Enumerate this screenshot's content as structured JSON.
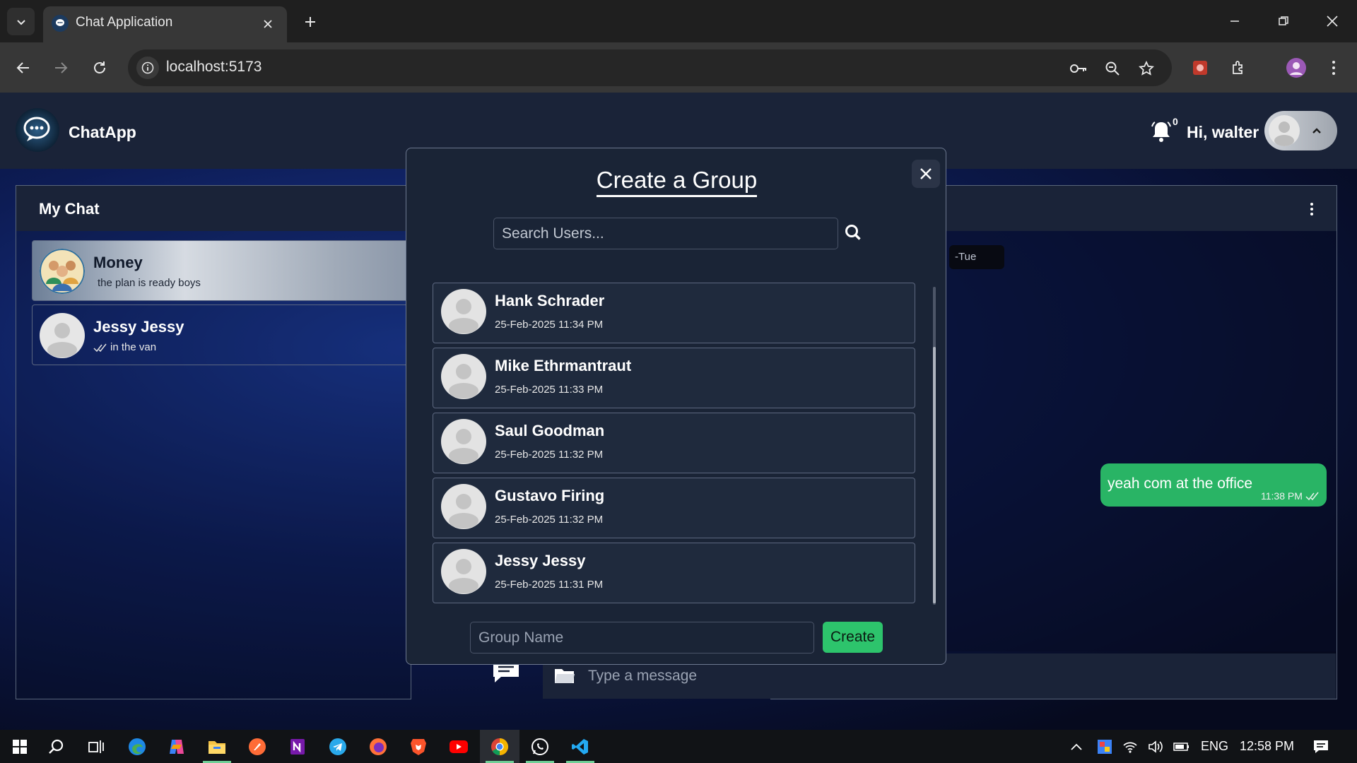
{
  "browser": {
    "tab_title": "Chat Application",
    "url": "localhost:5173"
  },
  "app": {
    "brand": "ChatApp",
    "notification_count": "0",
    "greeting": "Hi, walter"
  },
  "my_chat": {
    "title": "My Chat",
    "items": [
      {
        "name": "Money",
        "last_message": "the plan is ready boys",
        "active": true
      },
      {
        "name": "Jessy Jessy",
        "last_message": "in the van",
        "active": false
      }
    ]
  },
  "conversation": {
    "date_chip": "-Tue",
    "messages": [
      {
        "text": "yeah com at the office",
        "time": "11:38 PM",
        "sent": true
      }
    ],
    "input_placeholder": "Type a message"
  },
  "modal": {
    "title": "Create a Group",
    "search_placeholder": "Search Users...",
    "users": [
      {
        "name": "Hank Schrader",
        "date": "25-Feb-2025 11:34 PM"
      },
      {
        "name": "Mike Ethrmantraut",
        "date": "25-Feb-2025 11:33 PM"
      },
      {
        "name": "Saul Goodman",
        "date": "25-Feb-2025 11:32 PM"
      },
      {
        "name": "Gustavo Firing",
        "date": "25-Feb-2025 11:32 PM"
      },
      {
        "name": "Jessy Jessy",
        "date": "25-Feb-2025 11:31 PM"
      }
    ],
    "group_name_placeholder": "Group Name",
    "create_label": "Create"
  },
  "taskbar": {
    "language": "ENG",
    "time": "12:58 PM"
  },
  "colors": {
    "accent_green": "#2dc46c",
    "header_bg": "#1a2338",
    "modal_bg": "#1a2436"
  }
}
